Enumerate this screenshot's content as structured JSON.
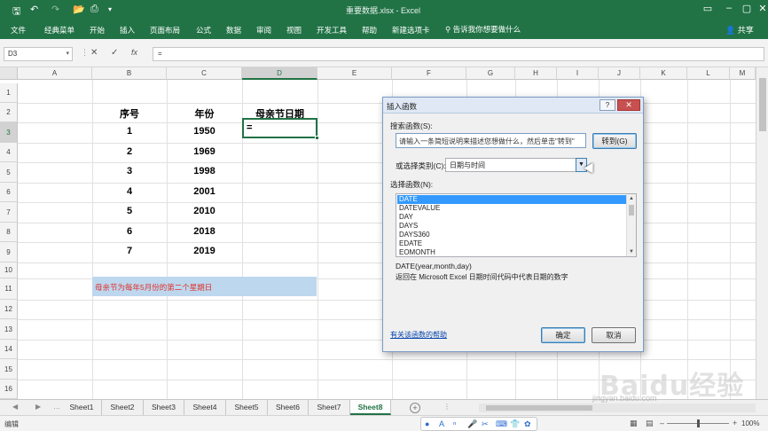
{
  "app": {
    "window_title": "重要数据.xlsx - Excel",
    "quick_access": [
      "save-icon",
      "undo-icon",
      "redo-icon",
      "open-icon",
      "print-preview-icon",
      "customize-icon"
    ]
  },
  "ribbon": {
    "tabs": [
      "文件",
      "经典菜单",
      "开始",
      "插入",
      "页面布局",
      "公式",
      "数据",
      "审阅",
      "视图",
      "开发工具",
      "帮助",
      "新建选项卡"
    ],
    "tell_me": "告诉我你想要做什么",
    "share": "共享"
  },
  "formula_bar": {
    "name_box": "D3",
    "cancel": "✕",
    "enter": "✓",
    "fx": "fx",
    "content": "="
  },
  "grid": {
    "columns": [
      "A",
      "B",
      "C",
      "D",
      "E",
      "F",
      "G",
      "H",
      "I",
      "J",
      "K",
      "L",
      "M"
    ],
    "rows": [
      "1",
      "2",
      "3",
      "4",
      "5",
      "6",
      "7",
      "8",
      "9",
      "10",
      "11",
      "12",
      "13",
      "14",
      "15",
      "16"
    ],
    "headers": {
      "seq": "序号",
      "year": "年份",
      "mothers_day": "母亲节日期"
    },
    "data": [
      {
        "seq": "1",
        "year": "1950"
      },
      {
        "seq": "2",
        "year": "1969"
      },
      {
        "seq": "3",
        "year": "1998"
      },
      {
        "seq": "4",
        "year": "2001"
      },
      {
        "seq": "5",
        "year": "2010"
      },
      {
        "seq": "6",
        "year": "2018"
      },
      {
        "seq": "7",
        "year": "2019"
      }
    ],
    "active_cell_value": "=",
    "note": "母亲节为每年5月份的第二个星期日"
  },
  "sheets": {
    "tabs": [
      "Sheet1",
      "Sheet2",
      "Sheet3",
      "Sheet4",
      "Sheet5",
      "Sheet6",
      "Sheet7",
      "Sheet8"
    ],
    "active": "Sheet8",
    "add": "+"
  },
  "status": {
    "mode": "编辑",
    "zoom": "100%"
  },
  "dialog": {
    "title": "插入函数",
    "help": "?",
    "close": "✕",
    "search_label": "搜索函数(S):",
    "search_placeholder": "请输入一条简短说明来描述您想做什么，然后单击\"转到\"",
    "go_button": "转到(G)",
    "category_label": "或选择类别(C):",
    "category_value": "日期与时间",
    "select_label": "选择函数(N):",
    "functions": [
      "DATE",
      "DATEVALUE",
      "DAY",
      "DAYS",
      "DAYS360",
      "EDATE",
      "EOMONTH"
    ],
    "selected_function": "DATE",
    "signature": "DATE(year,month,day)",
    "description": "返回在 Microsoft Excel 日期时间代码中代表日期的数字",
    "help_link": "有关该函数的帮助",
    "ok": "确定",
    "cancel": "取消"
  },
  "watermark": {
    "text": "Baidu经验",
    "url": "jingyan.baidu.com"
  }
}
